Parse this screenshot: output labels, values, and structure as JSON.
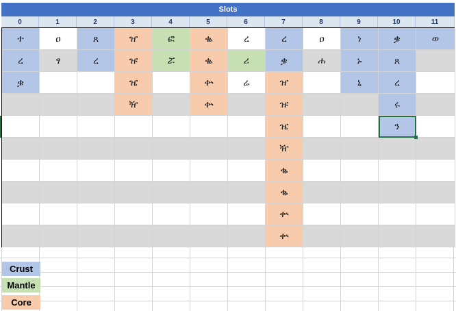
{
  "title": "Slots",
  "columns": [
    "0",
    "1",
    "2",
    "3",
    "4",
    "5",
    "6",
    "7",
    "8",
    "9",
    "10",
    "11"
  ],
  "colors": {
    "crust": "#b4c6e7",
    "mantle": "#c6e0b4",
    "core": "#f8cbad",
    "header": "#4472c4",
    "stripe": "#d9d9d9"
  },
  "grid": {
    "rows": [
      [
        {
          "t": "ተ",
          "c": "crust"
        },
        {
          "t": "ዐ",
          "c": ""
        },
        {
          "t": "ጸ",
          "c": "crust"
        },
        {
          "t": "ዠ",
          "c": "core"
        },
        {
          "t": "ፎ",
          "c": "mantle"
        },
        {
          "t": "ቈ",
          "c": "core"
        },
        {
          "t": "ረ",
          "c": ""
        },
        {
          "t": "ረ",
          "c": "crust"
        },
        {
          "t": "ዐ",
          "c": ""
        },
        {
          "t": "ነ",
          "c": "crust"
        },
        {
          "t": "ቌ",
          "c": "crust"
        },
        {
          "t": "ወ",
          "c": "crust"
        }
      ],
      [
        {
          "t": "ረ",
          "c": "crust"
        },
        {
          "t": "ፃ",
          "c": "stripe"
        },
        {
          "t": "ረ",
          "c": "crust"
        },
        {
          "t": "ዡ",
          "c": "core"
        },
        {
          "t": "ሯ",
          "c": "mantle"
        },
        {
          "t": "ቈ",
          "c": "core"
        },
        {
          "t": "ሪ",
          "c": "mantle"
        },
        {
          "t": "ቌ",
          "c": "crust"
        },
        {
          "t": "ሐ",
          "c": "stripe"
        },
        {
          "t": "ኑ",
          "c": "crust"
        },
        {
          "t": "ጸ",
          "c": "crust"
        },
        {
          "t": "",
          "c": "stripe"
        }
      ],
      [
        {
          "t": "ቌ",
          "c": "crust"
        },
        {
          "t": "",
          "c": ""
        },
        {
          "t": "",
          "c": ""
        },
        {
          "t": "ዤ",
          "c": "core"
        },
        {
          "t": "",
          "c": ""
        },
        {
          "t": "ቍ",
          "c": "core"
        },
        {
          "t": "ሬ",
          "c": ""
        },
        {
          "t": "ዠ",
          "c": "core"
        },
        {
          "t": "",
          "c": ""
        },
        {
          "t": "ኒ",
          "c": "crust"
        },
        {
          "t": "ረ",
          "c": "crust"
        },
        {
          "t": "",
          "c": ""
        }
      ],
      [
        {
          "t": "",
          "c": "stripe"
        },
        {
          "t": "",
          "c": "stripe"
        },
        {
          "t": "",
          "c": "stripe"
        },
        {
          "t": "ዥ",
          "c": "core"
        },
        {
          "t": "",
          "c": "stripe"
        },
        {
          "t": "ቍ",
          "c": "core"
        },
        {
          "t": "",
          "c": "stripe"
        },
        {
          "t": "ዡ",
          "c": "core"
        },
        {
          "t": "",
          "c": "stripe"
        },
        {
          "t": "",
          "c": "stripe"
        },
        {
          "t": "ሩ",
          "c": "crust"
        },
        {
          "t": "",
          "c": "stripe"
        }
      ],
      [
        {
          "t": "",
          "c": ""
        },
        {
          "t": "",
          "c": ""
        },
        {
          "t": "",
          "c": ""
        },
        {
          "t": "",
          "c": ""
        },
        {
          "t": "",
          "c": ""
        },
        {
          "t": "",
          "c": ""
        },
        {
          "t": "",
          "c": ""
        },
        {
          "t": "ዤ",
          "c": "core"
        },
        {
          "t": "",
          "c": ""
        },
        {
          "t": "",
          "c": ""
        },
        {
          "t": "ን",
          "c": "crust selected"
        },
        {
          "t": "",
          "c": ""
        }
      ],
      [
        {
          "t": "",
          "c": "stripe"
        },
        {
          "t": "",
          "c": "stripe"
        },
        {
          "t": "",
          "c": "stripe"
        },
        {
          "t": "",
          "c": "stripe"
        },
        {
          "t": "",
          "c": "stripe"
        },
        {
          "t": "",
          "c": "stripe"
        },
        {
          "t": "",
          "c": "stripe"
        },
        {
          "t": "ዥ",
          "c": "core"
        },
        {
          "t": "",
          "c": "stripe"
        },
        {
          "t": "",
          "c": "stripe"
        },
        {
          "t": "",
          "c": "stripe"
        },
        {
          "t": "",
          "c": "stripe"
        }
      ],
      [
        {
          "t": "",
          "c": ""
        },
        {
          "t": "",
          "c": ""
        },
        {
          "t": "",
          "c": ""
        },
        {
          "t": "",
          "c": ""
        },
        {
          "t": "",
          "c": ""
        },
        {
          "t": "",
          "c": ""
        },
        {
          "t": "",
          "c": ""
        },
        {
          "t": "ቈ",
          "c": "core"
        },
        {
          "t": "",
          "c": ""
        },
        {
          "t": "",
          "c": ""
        },
        {
          "t": "",
          "c": ""
        },
        {
          "t": "",
          "c": ""
        }
      ],
      [
        {
          "t": "",
          "c": "stripe"
        },
        {
          "t": "",
          "c": "stripe"
        },
        {
          "t": "",
          "c": "stripe"
        },
        {
          "t": "",
          "c": "stripe"
        },
        {
          "t": "",
          "c": "stripe"
        },
        {
          "t": "",
          "c": "stripe"
        },
        {
          "t": "",
          "c": "stripe"
        },
        {
          "t": "ቈ",
          "c": "core"
        },
        {
          "t": "",
          "c": "stripe"
        },
        {
          "t": "",
          "c": "stripe"
        },
        {
          "t": "",
          "c": "stripe"
        },
        {
          "t": "",
          "c": "stripe"
        }
      ],
      [
        {
          "t": "",
          "c": ""
        },
        {
          "t": "",
          "c": ""
        },
        {
          "t": "",
          "c": ""
        },
        {
          "t": "",
          "c": ""
        },
        {
          "t": "",
          "c": ""
        },
        {
          "t": "",
          "c": ""
        },
        {
          "t": "",
          "c": ""
        },
        {
          "t": "ቍ",
          "c": "core"
        },
        {
          "t": "",
          "c": ""
        },
        {
          "t": "",
          "c": ""
        },
        {
          "t": "",
          "c": ""
        },
        {
          "t": "",
          "c": ""
        }
      ],
      [
        {
          "t": "",
          "c": "stripe"
        },
        {
          "t": "",
          "c": "stripe"
        },
        {
          "t": "",
          "c": "stripe"
        },
        {
          "t": "",
          "c": "stripe"
        },
        {
          "t": "",
          "c": "stripe"
        },
        {
          "t": "",
          "c": "stripe"
        },
        {
          "t": "",
          "c": "stripe"
        },
        {
          "t": "ቍ",
          "c": "core"
        },
        {
          "t": "",
          "c": "stripe"
        },
        {
          "t": "",
          "c": "stripe"
        },
        {
          "t": "",
          "c": "stripe"
        },
        {
          "t": "",
          "c": "stripe"
        }
      ]
    ]
  },
  "legend": [
    {
      "label": "Crust",
      "c": "crust"
    },
    {
      "label": "Mantle",
      "c": "mantle"
    },
    {
      "label": "Core",
      "c": "core"
    }
  ]
}
